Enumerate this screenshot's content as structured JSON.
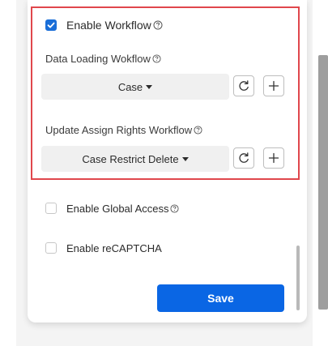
{
  "workflow": {
    "enable_label": "Enable Workflow",
    "enable_checked": true,
    "data_loading": {
      "label": "Data Loading Wokflow",
      "value": "Case"
    },
    "update_assign_rights": {
      "label": "Update Assign Rights Workflow",
      "value": "Case Restrict Delete"
    }
  },
  "options": {
    "global_access_label": "Enable Global Access",
    "global_access_checked": false,
    "recaptcha_label": "Enable reCAPTCHA",
    "recaptcha_checked": false
  },
  "save_label": "Save",
  "colors": {
    "accent": "#0a66e4",
    "checkbox": "#1a6ed8",
    "highlight_border": "#e0474c"
  },
  "icons": {
    "help": "help-circle-icon",
    "refresh": "refresh-icon",
    "add": "plus-icon",
    "check": "checkmark-icon"
  }
}
